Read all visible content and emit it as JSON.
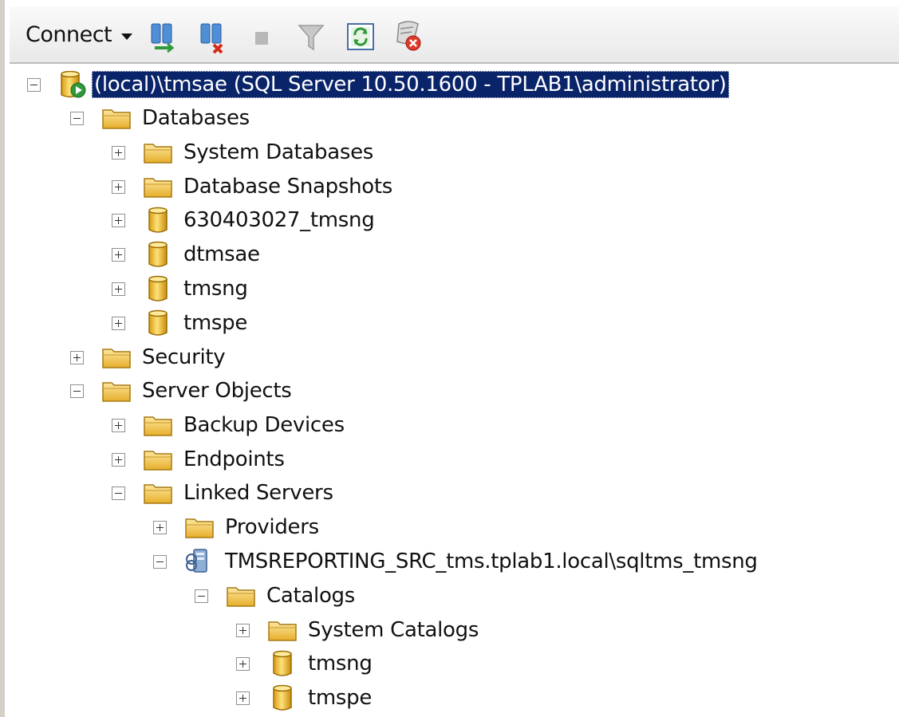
{
  "toolbar": {
    "connect_label": "Connect",
    "buttons": [
      "connect-object-explorer-icon",
      "disconnect-icon",
      "stop-icon",
      "filter-icon",
      "refresh-icon",
      "sync-activity-icon"
    ]
  },
  "tree": {
    "server": "(local)\\tmsae (SQL Server 10.50.1600 - TPLAB1\\administrator)",
    "databases": "Databases",
    "system_databases": "System Databases",
    "database_snapshots": "Database Snapshots",
    "db_630403027_tmsng": "630403027_tmsng",
    "db_dtmsae": "dtmsae",
    "db_tmsng": "tmsng",
    "db_tmspe": "tmspe",
    "security": "Security",
    "server_objects": "Server Objects",
    "backup_devices": "Backup Devices",
    "endpoints": "Endpoints",
    "linked_servers": "Linked Servers",
    "providers": "Providers",
    "linked_server": "TMSREPORTING_SRC_tms.tplab1.local\\sqltms_tmsng",
    "catalogs": "Catalogs",
    "system_catalogs": "System Catalogs",
    "catalog_tmsng": "tmsng",
    "catalog_tmspe": "tmspe"
  },
  "colors": {
    "selection": "#0a246a",
    "folder": "#f3c23c",
    "database": "#e8b21c"
  }
}
